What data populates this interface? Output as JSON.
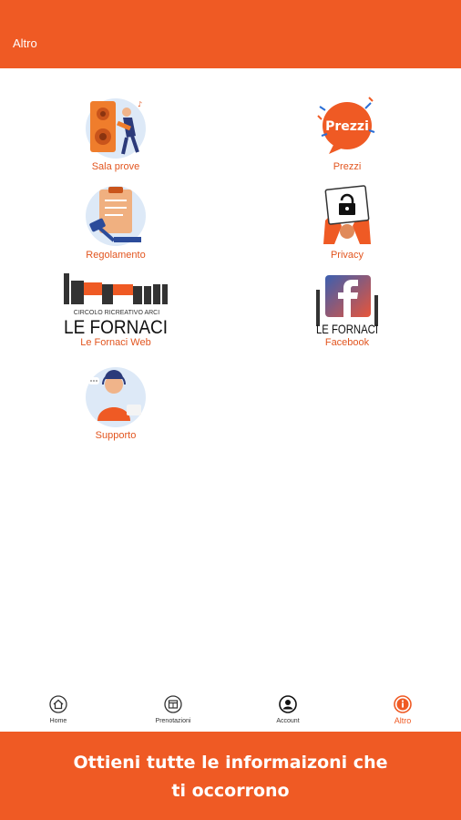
{
  "header": {
    "title": "Altro"
  },
  "menu": {
    "sala_prove": "Sala prove",
    "prezzi": "Prezzi",
    "prezzi_badge": "Prezzi",
    "regolamento": "Regolamento",
    "privacy": "Privacy",
    "fornaci_web": "Le Fornaci Web",
    "facebook": "Facebook",
    "supporto": "Supporto"
  },
  "logo": {
    "circolo": "CIRCOLO RICREATIVO ARCI",
    "name": "LE FORNACI"
  },
  "bottom_nav": {
    "home": "Home",
    "prenotazioni": "Prenotazioni",
    "account": "Account",
    "altro": "Altro"
  },
  "banner": {
    "line1": "Ottieni tutte le informaizoni che",
    "line2": "ti occorrono"
  },
  "colors": {
    "accent": "#ef5a24",
    "label": "#e2551f",
    "facebook": "#3b5998"
  }
}
